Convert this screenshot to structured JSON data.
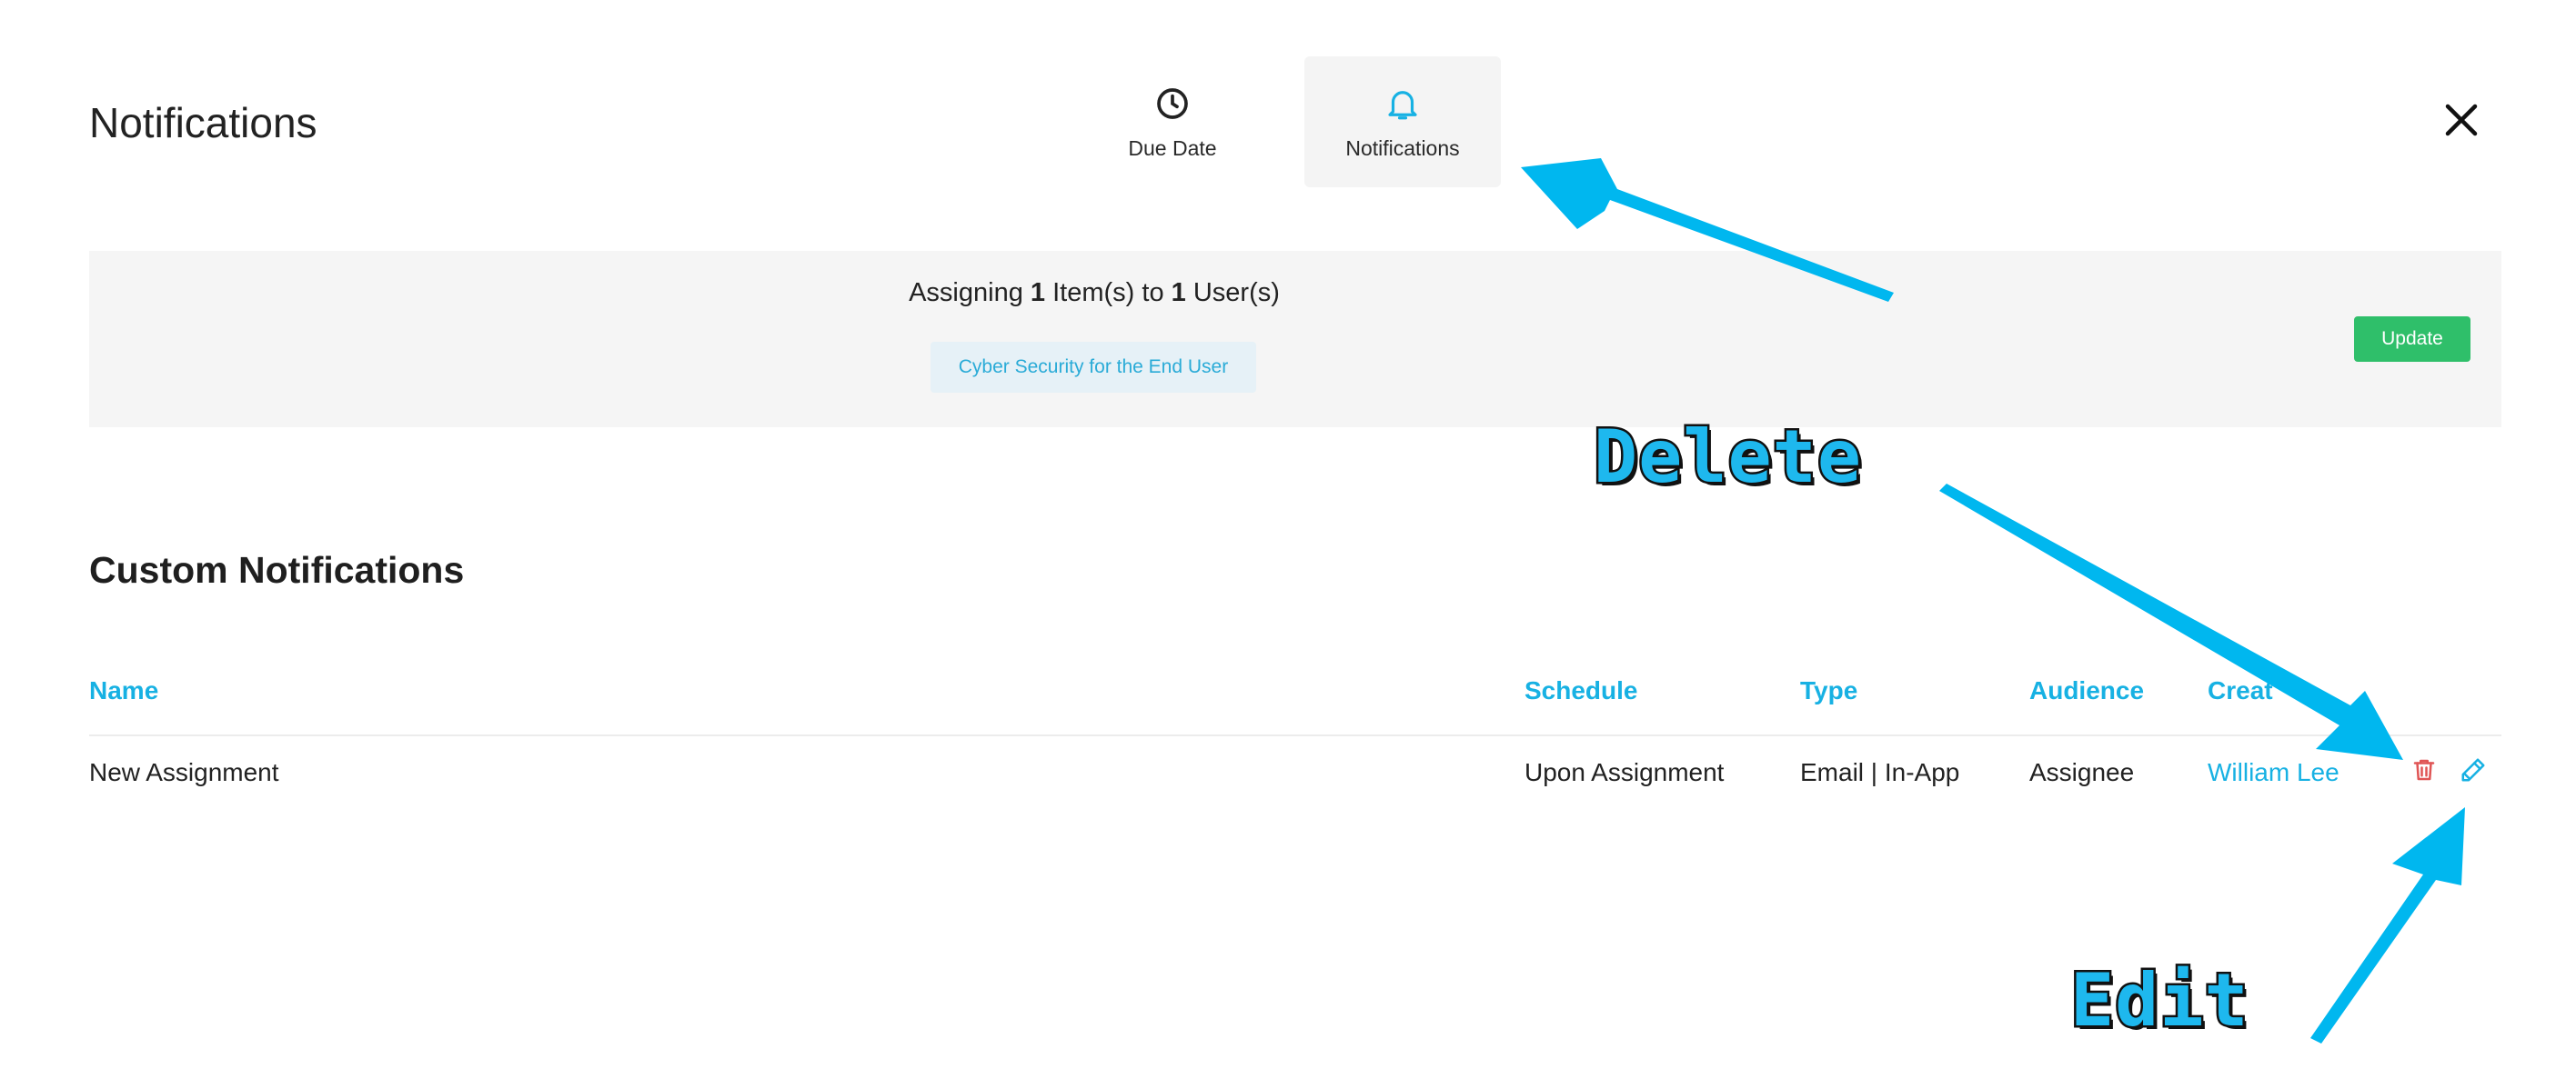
{
  "header": {
    "title": "Notifications",
    "tabs": [
      {
        "label": "Due Date",
        "icon": "clock-icon",
        "active": false
      },
      {
        "label": "Notifications",
        "icon": "bell-icon",
        "active": true
      }
    ],
    "close_icon": "close-icon"
  },
  "banner": {
    "assign_prefix": "Assigning",
    "item_count": "1",
    "item_middle": "Item(s) to",
    "user_count": "1",
    "user_suffix": "User(s)",
    "item_chip": "Cyber Security for the End User",
    "update_label": "Update"
  },
  "section": {
    "title": "Custom Notifications"
  },
  "table": {
    "columns": [
      "Name",
      "Schedule",
      "Type",
      "Audience",
      "Creat"
    ],
    "rows": [
      {
        "name": "New Assignment",
        "schedule": "Upon Assignment",
        "type": "Email | In-App",
        "audience": "Assignee",
        "creator": "William Lee",
        "actions": [
          "trash-icon",
          "pencil-icon"
        ]
      }
    ]
  },
  "annotations": {
    "delete_label": "Delete",
    "edit_label": "Edit"
  },
  "colors": {
    "accent": "#17b1e3",
    "update_button": "#2fbf6a",
    "delete_icon": "#e05555",
    "annotation": "#1eb8ee"
  }
}
